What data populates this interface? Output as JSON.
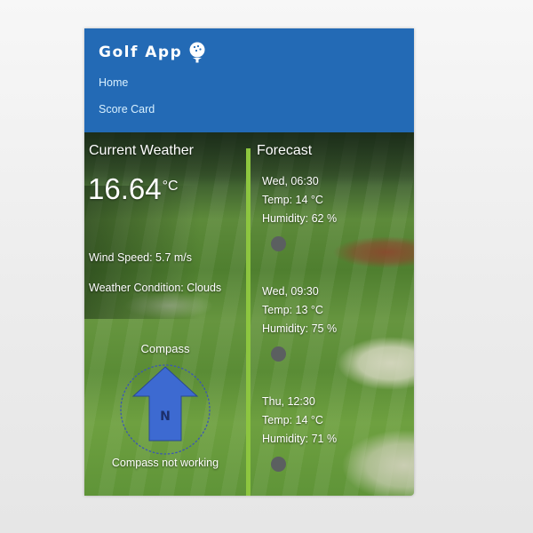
{
  "app": {
    "title": "Golf App",
    "icon": "golf-ball-tee-icon"
  },
  "nav": [
    {
      "label": "Home"
    },
    {
      "label": "Score Card"
    }
  ],
  "current": {
    "title": "Current Weather",
    "temperature": "16.64",
    "temperature_unit": "°C",
    "wind": "Wind Speed: 5.7 m/s",
    "condition": "Weather Condition: Clouds",
    "compass_title": "Compass",
    "compass_letter": "N",
    "compass_status": "Compass not working"
  },
  "forecast": {
    "title": "Forecast",
    "items": [
      {
        "time": "Wed, 06:30",
        "temp": "Temp: 14 °C",
        "humidity": "Humidity: 62 %",
        "icon": "weather-icon"
      },
      {
        "time": "Wed, 09:30",
        "temp": "Temp: 13 °C",
        "humidity": "Humidity: 75 %",
        "icon": "weather-icon"
      },
      {
        "time": "Thu, 12:30",
        "temp": "Temp: 14 °C",
        "humidity": "Humidity: 71 %",
        "icon": "weather-icon"
      }
    ]
  },
  "colors": {
    "header": "#236ab5",
    "divider": "#8dc63f",
    "compass_arrow": "#3d6ad1"
  }
}
